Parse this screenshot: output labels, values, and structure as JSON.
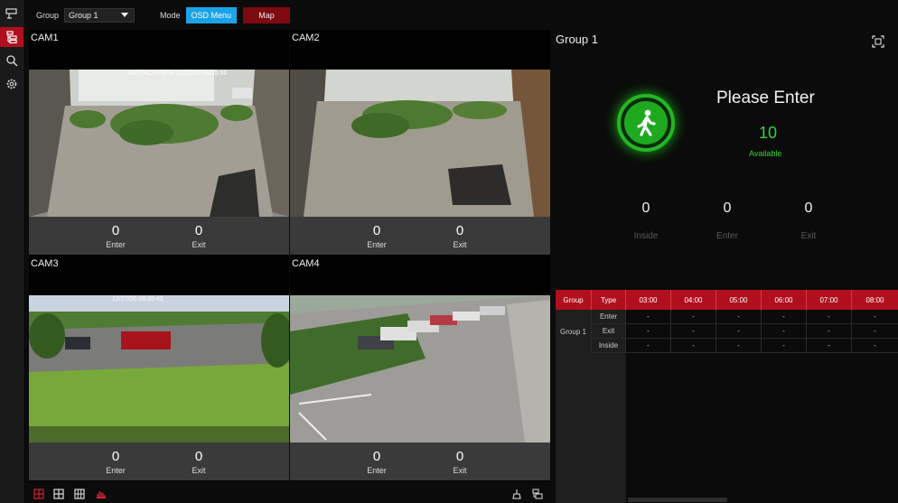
{
  "topbar": {
    "group_label": "Group",
    "group_value": "Group 1",
    "mode_label": "Mode",
    "osd_button": "OSD Menu",
    "map_button": "Map"
  },
  "cameras": [
    {
      "title": "CAM1",
      "enter": "0",
      "exit": "0",
      "enter_label": "Enter",
      "exit_label": "Exit"
    },
    {
      "title": "CAM2",
      "enter": "0",
      "exit": "0",
      "enter_label": "Enter",
      "exit_label": "Exit"
    },
    {
      "title": "CAM3",
      "enter": "0",
      "exit": "0",
      "enter_label": "Enter",
      "exit_label": "Exit"
    },
    {
      "title": "CAM4",
      "enter": "0",
      "exit": "0",
      "enter_label": "Enter",
      "exit_label": "Exit"
    }
  ],
  "panel": {
    "title": "Group 1",
    "status": "Please Enter",
    "available_count": "10",
    "available_label": "Available",
    "counters": [
      {
        "value": "0",
        "label": "Inside"
      },
      {
        "value": "0",
        "label": "Enter"
      },
      {
        "value": "0",
        "label": "Exit"
      }
    ]
  },
  "table": {
    "headers": [
      "Group",
      "Type",
      "03:00",
      "04:00",
      "05:00",
      "06:00",
      "07:00",
      "08:00"
    ],
    "group": "Group 1",
    "rows": [
      {
        "type": "Enter",
        "values": [
          "-",
          "-",
          "-",
          "-",
          "-",
          "-"
        ]
      },
      {
        "type": "Exit",
        "values": [
          "-",
          "-",
          "-",
          "-",
          "-",
          "-"
        ]
      },
      {
        "type": "Inside",
        "values": [
          "-",
          "-",
          "-",
          "-",
          "-",
          "-"
        ]
      }
    ]
  },
  "colors": {
    "accent_red": "#b10f1d",
    "osd_blue": "#1ca3e6",
    "available_green": "#33d433"
  },
  "icons": {
    "rail": [
      "camera-icon",
      "group-tree-icon",
      "search-icon",
      "settings-icon"
    ],
    "bottom": [
      "layout-4-icon",
      "layout-9-icon",
      "layout-16-icon",
      "people-counting-icon",
      "clear-icon",
      "record-icon"
    ],
    "panel": [
      "walking-person-icon",
      "fullscreen-icon"
    ]
  }
}
